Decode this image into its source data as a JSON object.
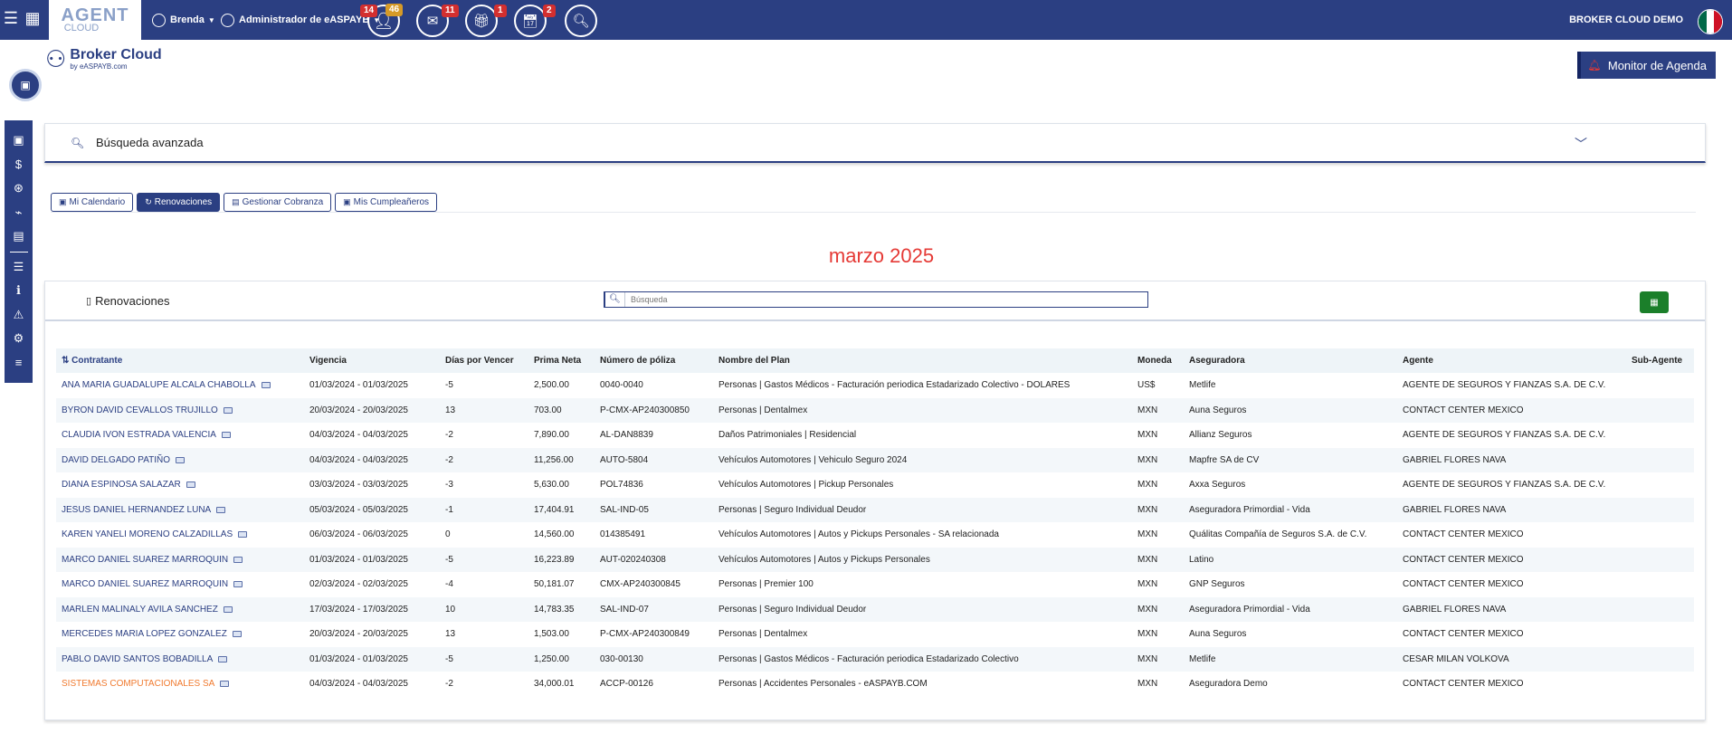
{
  "topbar": {
    "logo_main": "AGENT",
    "logo_sub": "CLOUD",
    "user_name": "Brenda",
    "admin_name": "Administrador de eASPAYB",
    "badges": {
      "clients": "14",
      "clients_orange": "46",
      "mail": "11",
      "gifts": "1",
      "calendar": "2"
    },
    "brand": "BROKER CLOUD DEMO"
  },
  "app": {
    "title": "Broker Cloud",
    "subtitle": "by eASPAYB.com"
  },
  "monitor_label": "Monitor de Agenda",
  "search_panel": {
    "label": "Búsqueda avanzada"
  },
  "tabs": [
    {
      "label": "Mi Calendario"
    },
    {
      "label": "Renovaciones"
    },
    {
      "label": "Gestionar Cobranza"
    },
    {
      "label": "Mis Cumpleañeros"
    }
  ],
  "month": "marzo 2025",
  "card": {
    "title": "Renovaciones",
    "search_placeholder": "Búsqueda"
  },
  "table": {
    "headers": [
      "Contratante",
      "Vigencia",
      "Días por Vencer",
      "Prima Neta",
      "Número de póliza",
      "Nombre del Plan",
      "Moneda",
      "Aseguradora",
      "Agente",
      "Sub-Agente"
    ],
    "rows": [
      [
        "ANA MARIA GUADALUPE ALCALA CHABOLLA",
        "01/03/2024 - 01/03/2025",
        "-5",
        "2,500.00",
        "0040-0040",
        "Personas | Gastos Médicos - Facturación periodica Estadarizado Colectivo - DOLARES",
        "US$",
        "Metlife",
        "AGENTE DE SEGUROS Y FIANZAS S.A. DE C.V.",
        ""
      ],
      [
        "BYRON DAVID CEVALLOS TRUJILLO",
        "20/03/2024 - 20/03/2025",
        "13",
        "703.00",
        "P-CMX-AP240300850",
        "Personas | Dentalmex",
        "MXN",
        "Auna Seguros",
        "CONTACT CENTER MEXICO",
        ""
      ],
      [
        "CLAUDIA IVON ESTRADA VALENCIA",
        "04/03/2024 - 04/03/2025",
        "-2",
        "7,890.00",
        "AL-DAN8839",
        "Daños Patrimoniales | Residencial",
        "MXN",
        "Allianz Seguros",
        "AGENTE DE SEGUROS Y FIANZAS S.A. DE C.V.",
        ""
      ],
      [
        "DAVID DELGADO PATIÑO",
        "04/03/2024 - 04/03/2025",
        "-2",
        "11,256.00",
        "AUTO-5804",
        "Vehículos Automotores | Vehiculo Seguro 2024",
        "MXN",
        "Mapfre SA de CV",
        "GABRIEL FLORES NAVA",
        ""
      ],
      [
        "DIANA ESPINOSA SALAZAR",
        "03/03/2024 - 03/03/2025",
        "-3",
        "5,630.00",
        "POL74836",
        "Vehículos Automotores | Pickup Personales",
        "MXN",
        "Axxa Seguros",
        "AGENTE DE SEGUROS Y FIANZAS S.A. DE C.V.",
        ""
      ],
      [
        "JESUS DANIEL HERNANDEZ LUNA",
        "05/03/2024 - 05/03/2025",
        "-1",
        "17,404.91",
        "SAL-IND-05",
        "Personas | Seguro Individual Deudor",
        "MXN",
        "Aseguradora Primordial - Vida",
        "GABRIEL FLORES NAVA",
        ""
      ],
      [
        "KAREN YANELI MORENO CALZADILLAS",
        "06/03/2024 - 06/03/2025",
        "0",
        "14,560.00",
        "014385491",
        "Vehículos Automotores | Autos y Pickups Personales - SA relacionada",
        "MXN",
        "Quálitas Compañía de Seguros S.A. de C.V.",
        "CONTACT CENTER MEXICO",
        ""
      ],
      [
        "MARCO DANIEL SUAREZ MARROQUIN",
        "01/03/2024 - 01/03/2025",
        "-5",
        "16,223.89",
        "AUT-020240308",
        "Vehículos Automotores | Autos y Pickups Personales",
        "MXN",
        "Latino",
        "CONTACT CENTER MEXICO",
        ""
      ],
      [
        "MARCO DANIEL SUAREZ MARROQUIN",
        "02/03/2024 - 02/03/2025",
        "-4",
        "50,181.07",
        "CMX-AP240300845",
        "Personas | Premier 100",
        "MXN",
        "GNP Seguros",
        "CONTACT CENTER MEXICO",
        ""
      ],
      [
        "MARLEN MALINALY AVILA SANCHEZ",
        "17/03/2024 - 17/03/2025",
        "10",
        "14,783.35",
        "SAL-IND-07",
        "Personas | Seguro Individual Deudor",
        "MXN",
        "Aseguradora Primordial - Vida",
        "GABRIEL FLORES NAVA",
        ""
      ],
      [
        "MERCEDES MARIA LOPEZ GONZALEZ",
        "20/03/2024 - 20/03/2025",
        "13",
        "1,503.00",
        "P-CMX-AP240300849",
        "Personas | Dentalmex",
        "MXN",
        "Auna Seguros",
        "CONTACT CENTER MEXICO",
        ""
      ],
      [
        "PABLO DAVID SANTOS BOBADILLA",
        "01/03/2024 - 01/03/2025",
        "-5",
        "1,250.00",
        "030-00130",
        "Personas | Gastos Médicos - Facturación periodica Estadarizado Colectivo",
        "MXN",
        "Metlife",
        "CESAR MILAN VOLKOVA",
        ""
      ],
      [
        "SISTEMAS COMPUTACIONALES SA",
        "04/03/2024 - 04/03/2025",
        "-2",
        "34,000.01",
        "ACCP-00126",
        "Personas | Accidentes Personales - eASPAYB.COM",
        "MXN",
        "Aseguradora Demo",
        "CONTACT CENTER MEXICO",
        ""
      ]
    ]
  },
  "colors": {
    "primary": "#2b3f82",
    "accent_red": "#e53935",
    "excel_green": "#1b7f2a",
    "company_orange": "#f07a2f"
  }
}
